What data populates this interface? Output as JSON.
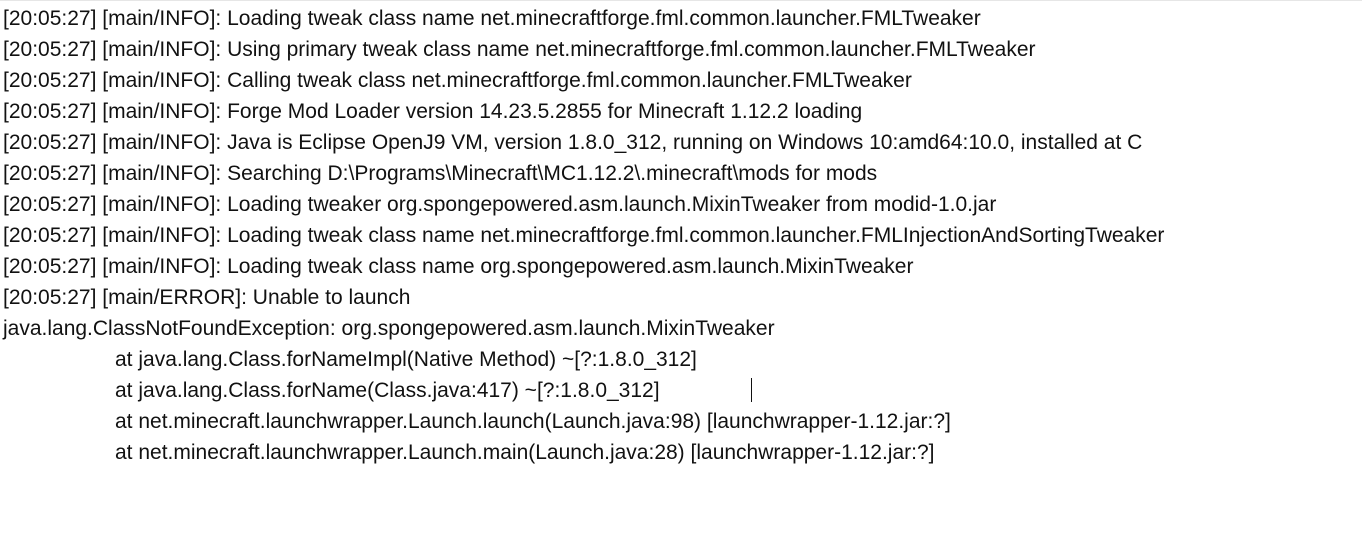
{
  "log": {
    "lines": [
      "[20:05:27] [main/INFO]: Loading tweak class name net.minecraftforge.fml.common.launcher.FMLTweaker",
      "[20:05:27] [main/INFO]: Using primary tweak class name net.minecraftforge.fml.common.launcher.FMLTweaker",
      "[20:05:27] [main/INFO]: Calling tweak class net.minecraftforge.fml.common.launcher.FMLTweaker",
      "[20:05:27] [main/INFO]: Forge Mod Loader version 14.23.5.2855 for Minecraft 1.12.2 loading",
      "[20:05:27] [main/INFO]: Java is Eclipse OpenJ9 VM, version 1.8.0_312, running on Windows 10:amd64:10.0, installed at C",
      "[20:05:27] [main/INFO]: Searching D:\\Programs\\Minecraft\\MC1.12.2\\.minecraft\\mods for mods",
      "[20:05:27] [main/INFO]: Loading tweaker org.spongepowered.asm.launch.MixinTweaker from modid-1.0.jar",
      "[20:05:27] [main/INFO]: Loading tweak class name net.minecraftforge.fml.common.launcher.FMLInjectionAndSortingTweaker",
      "[20:05:27] [main/INFO]: Loading tweak class name org.spongepowered.asm.launch.MixinTweaker",
      "[20:05:27] [main/ERROR]: Unable to launch",
      "java.lang.ClassNotFoundException: org.spongepowered.asm.launch.MixinTweaker",
      "at java.lang.Class.forNameImpl(Native Method) ~[?:1.8.0_312]",
      "at java.lang.Class.forName(Class.java:417) ~[?:1.8.0_312]",
      "at net.minecraft.launchwrapper.Launch.launch(Launch.java:98) [launchwrapper-1.12.jar:?]",
      "at net.minecraft.launchwrapper.Launch.main(Launch.java:28) [launchwrapper-1.12.jar:?]"
    ]
  }
}
